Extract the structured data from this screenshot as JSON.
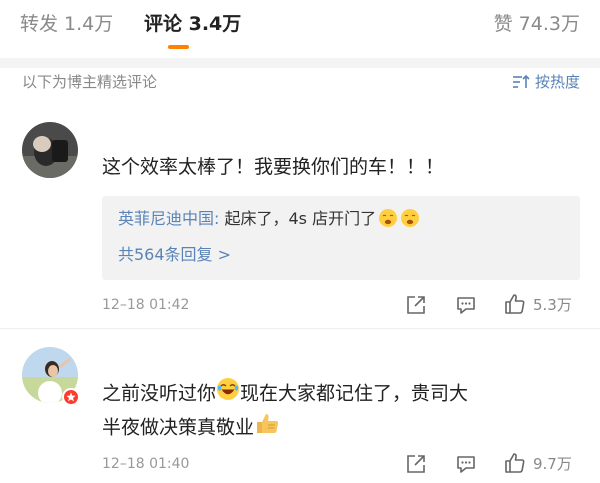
{
  "tabs": [
    {
      "label": "转发 1.4万"
    },
    {
      "label": "评论 3.4万"
    },
    {
      "label": "赞 74.3万"
    }
  ],
  "section": {
    "title": "以下为博主精选评论",
    "sort_label": "按热度"
  },
  "comments": [
    {
      "text": "这个效率太棒了！我要换你们的车！！！",
      "reply_author": "英菲尼迪中国:",
      "reply_text": " 起床了，4s 店开门了",
      "reply_count_label": "共564条回复 >",
      "time": "12–18 01:42",
      "likes": "5.3万"
    },
    {
      "text_line1_a": "之前没听过你",
      "text_line1_b": "现在大家都记住了，贵司大",
      "text_line2": "半夜做决策真敬业",
      "time": "12–18 01:40",
      "likes": "9.7万"
    }
  ],
  "colors": {
    "accent": "#ff8200",
    "link": "#5a84b8",
    "badge": "#ff3b30"
  }
}
